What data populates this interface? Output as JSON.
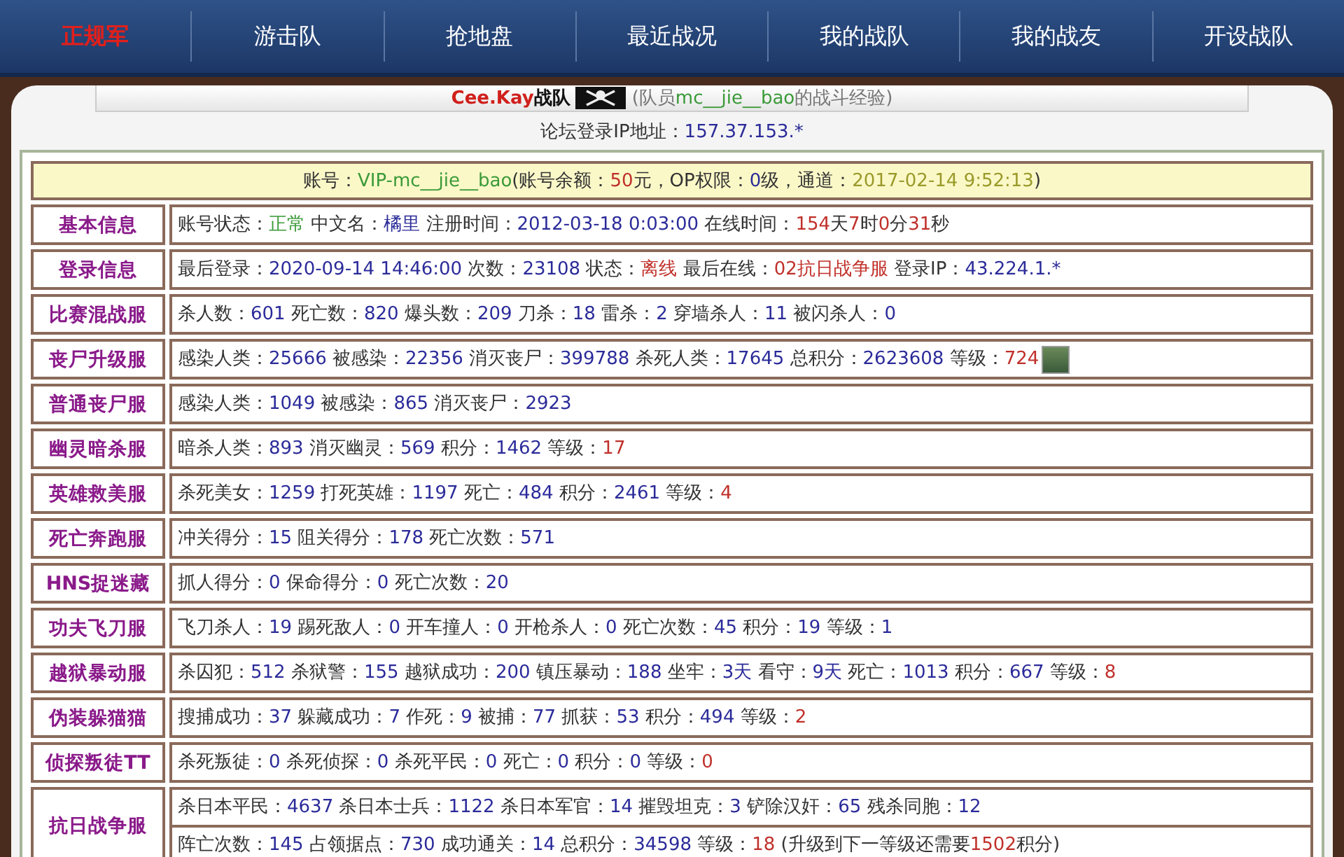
{
  "nav": {
    "items": [
      {
        "label": "正规军",
        "selected": true
      },
      {
        "label": "游击队",
        "selected": false
      },
      {
        "label": "抢地盘",
        "selected": false
      },
      {
        "label": "最近战况",
        "selected": false
      },
      {
        "label": "我的战队",
        "selected": false
      },
      {
        "label": "我的战友",
        "selected": false
      },
      {
        "label": "开设战队",
        "selected": false
      }
    ]
  },
  "header": {
    "team": "Cee.Kay",
    "team_suffix": "战队",
    "member_note": [
      {
        "text": "(队员",
        "kind": "muted"
      },
      {
        "text": "mc__jie__bao",
        "kind": "ok"
      },
      {
        "text": "的战斗经验)",
        "kind": "muted"
      }
    ]
  },
  "ip_line": [
    {
      "text": "论坛登录IP地址：",
      "kind": "label"
    },
    {
      "text": "157.37.153.*",
      "kind": "value"
    }
  ],
  "account": [
    {
      "text": "账号：",
      "kind": "label"
    },
    {
      "text": "VIP-mc__jie__bao",
      "kind": "ok"
    },
    {
      "text": "(账号余额：",
      "kind": "label"
    },
    {
      "text": "50",
      "kind": "alert"
    },
    {
      "text": "元，OP权限：",
      "kind": "label"
    },
    {
      "text": "0",
      "kind": "value"
    },
    {
      "text": "级，通道：",
      "kind": "label"
    },
    {
      "text": "2017-02-14 9:52:13",
      "kind": "date"
    },
    {
      "text": ")",
      "kind": "label"
    }
  ],
  "rows": [
    {
      "label": "基本信息",
      "lines": [
        [
          {
            "text": "账号状态：",
            "kind": "label"
          },
          {
            "text": "正常",
            "kind": "ok"
          },
          {
            "text": " 中文名：",
            "kind": "label"
          },
          {
            "text": "橘里",
            "kind": "value"
          },
          {
            "text": " 注册时间：",
            "kind": "label"
          },
          {
            "text": "2012-03-18 0:03:00",
            "kind": "value"
          },
          {
            "text": " 在线时间：",
            "kind": "label"
          },
          {
            "text": "154",
            "kind": "alert"
          },
          {
            "text": "天",
            "kind": "label"
          },
          {
            "text": "7",
            "kind": "alert"
          },
          {
            "text": "时",
            "kind": "label"
          },
          {
            "text": "0",
            "kind": "alert"
          },
          {
            "text": "分",
            "kind": "label"
          },
          {
            "text": "31",
            "kind": "alert"
          },
          {
            "text": "秒",
            "kind": "label"
          }
        ]
      ]
    },
    {
      "label": "登录信息",
      "lines": [
        [
          {
            "text": "最后登录：",
            "kind": "label"
          },
          {
            "text": "2020-09-14 14:46:00",
            "kind": "value"
          },
          {
            "text": " 次数：",
            "kind": "label"
          },
          {
            "text": "23108",
            "kind": "value"
          },
          {
            "text": " 状态：",
            "kind": "label"
          },
          {
            "text": "离线",
            "kind": "alert"
          },
          {
            "text": " 最后在线：",
            "kind": "label"
          },
          {
            "text": "02抗日战争服",
            "kind": "alert"
          },
          {
            "text": " 登录IP：",
            "kind": "label"
          },
          {
            "text": "43.224.1.*",
            "kind": "value"
          }
        ]
      ]
    },
    {
      "label": "比赛混战服",
      "lines": [
        [
          {
            "text": "杀人数：",
            "kind": "label"
          },
          {
            "text": "601",
            "kind": "value"
          },
          {
            "text": " 死亡数：",
            "kind": "label"
          },
          {
            "text": "820",
            "kind": "value"
          },
          {
            "text": " 爆头数：",
            "kind": "label"
          },
          {
            "text": "209",
            "kind": "value"
          },
          {
            "text": " 刀杀：",
            "kind": "label"
          },
          {
            "text": "18",
            "kind": "value"
          },
          {
            "text": " 雷杀：",
            "kind": "label"
          },
          {
            "text": "2",
            "kind": "value"
          },
          {
            "text": " 穿墙杀人：",
            "kind": "label"
          },
          {
            "text": "11",
            "kind": "value"
          },
          {
            "text": " 被闪杀人：",
            "kind": "label"
          },
          {
            "text": "0",
            "kind": "value"
          }
        ]
      ]
    },
    {
      "label": "丧尸升级服",
      "avatar": true,
      "lines": [
        [
          {
            "text": "感染人类：",
            "kind": "label"
          },
          {
            "text": "25666",
            "kind": "value"
          },
          {
            "text": " 被感染：",
            "kind": "label"
          },
          {
            "text": "22356",
            "kind": "value"
          },
          {
            "text": " 消灭丧尸：",
            "kind": "label"
          },
          {
            "text": "399788",
            "kind": "value"
          },
          {
            "text": " 杀死人类：",
            "kind": "label"
          },
          {
            "text": "17645",
            "kind": "value"
          },
          {
            "text": " 总积分：",
            "kind": "label"
          },
          {
            "text": "2623608",
            "kind": "value"
          },
          {
            "text": " 等级：",
            "kind": "label"
          },
          {
            "text": "724",
            "kind": "alert"
          }
        ]
      ]
    },
    {
      "label": "普通丧尸服",
      "lines": [
        [
          {
            "text": "感染人类：",
            "kind": "label"
          },
          {
            "text": "1049",
            "kind": "value"
          },
          {
            "text": " 被感染：",
            "kind": "label"
          },
          {
            "text": "865",
            "kind": "value"
          },
          {
            "text": " 消灭丧尸：",
            "kind": "label"
          },
          {
            "text": "2923",
            "kind": "value"
          }
        ]
      ]
    },
    {
      "label": "幽灵暗杀服",
      "lines": [
        [
          {
            "text": "暗杀人类：",
            "kind": "label"
          },
          {
            "text": "893",
            "kind": "value"
          },
          {
            "text": " 消灭幽灵：",
            "kind": "label"
          },
          {
            "text": "569",
            "kind": "value"
          },
          {
            "text": " 积分：",
            "kind": "label"
          },
          {
            "text": "1462",
            "kind": "value"
          },
          {
            "text": " 等级：",
            "kind": "label"
          },
          {
            "text": "17",
            "kind": "alert"
          }
        ]
      ]
    },
    {
      "label": "英雄救美服",
      "lines": [
        [
          {
            "text": "杀死美女：",
            "kind": "label"
          },
          {
            "text": "1259",
            "kind": "value"
          },
          {
            "text": " 打死英雄：",
            "kind": "label"
          },
          {
            "text": "1197",
            "kind": "value"
          },
          {
            "text": " 死亡：",
            "kind": "label"
          },
          {
            "text": "484",
            "kind": "value"
          },
          {
            "text": " 积分：",
            "kind": "label"
          },
          {
            "text": "2461",
            "kind": "value"
          },
          {
            "text": " 等级：",
            "kind": "label"
          },
          {
            "text": "4",
            "kind": "alert"
          }
        ]
      ]
    },
    {
      "label": "死亡奔跑服",
      "lines": [
        [
          {
            "text": "冲关得分：",
            "kind": "label"
          },
          {
            "text": "15",
            "kind": "value"
          },
          {
            "text": " 阻关得分：",
            "kind": "label"
          },
          {
            "text": "178",
            "kind": "value"
          },
          {
            "text": " 死亡次数：",
            "kind": "label"
          },
          {
            "text": "571",
            "kind": "value"
          }
        ]
      ]
    },
    {
      "label": "HNS捉迷藏",
      "lines": [
        [
          {
            "text": "抓人得分：",
            "kind": "label"
          },
          {
            "text": "0",
            "kind": "value"
          },
          {
            "text": " 保命得分：",
            "kind": "label"
          },
          {
            "text": "0",
            "kind": "value"
          },
          {
            "text": " 死亡次数：",
            "kind": "label"
          },
          {
            "text": "20",
            "kind": "value"
          }
        ]
      ]
    },
    {
      "label": "功夫飞刀服",
      "lines": [
        [
          {
            "text": "飞刀杀人：",
            "kind": "label"
          },
          {
            "text": "19",
            "kind": "value"
          },
          {
            "text": " 踢死敌人：",
            "kind": "label"
          },
          {
            "text": "0",
            "kind": "value"
          },
          {
            "text": " 开车撞人：",
            "kind": "label"
          },
          {
            "text": "0",
            "kind": "value"
          },
          {
            "text": " 开枪杀人：",
            "kind": "label"
          },
          {
            "text": "0",
            "kind": "value"
          },
          {
            "text": " 死亡次数：",
            "kind": "label"
          },
          {
            "text": "45",
            "kind": "value"
          },
          {
            "text": " 积分：",
            "kind": "label"
          },
          {
            "text": "19",
            "kind": "value"
          },
          {
            "text": " 等级：",
            "kind": "label"
          },
          {
            "text": "1",
            "kind": "value"
          }
        ]
      ]
    },
    {
      "label": "越狱暴动服",
      "lines": [
        [
          {
            "text": "杀囚犯：",
            "kind": "label"
          },
          {
            "text": "512",
            "kind": "value"
          },
          {
            "text": " 杀狱警：",
            "kind": "label"
          },
          {
            "text": "155",
            "kind": "value"
          },
          {
            "text": " 越狱成功：",
            "kind": "label"
          },
          {
            "text": "200",
            "kind": "value"
          },
          {
            "text": " 镇压暴动：",
            "kind": "label"
          },
          {
            "text": "188",
            "kind": "value"
          },
          {
            "text": " 坐牢：",
            "kind": "label"
          },
          {
            "text": "3天",
            "kind": "value"
          },
          {
            "text": " 看守：",
            "kind": "label"
          },
          {
            "text": "9天",
            "kind": "value"
          },
          {
            "text": " 死亡：",
            "kind": "label"
          },
          {
            "text": "1013",
            "kind": "value"
          },
          {
            "text": " 积分：",
            "kind": "label"
          },
          {
            "text": "667",
            "kind": "value"
          },
          {
            "text": " 等级：",
            "kind": "label"
          },
          {
            "text": "8",
            "kind": "alert"
          }
        ]
      ]
    },
    {
      "label": "伪装躲猫猫",
      "lines": [
        [
          {
            "text": "搜捕成功：",
            "kind": "label"
          },
          {
            "text": "37",
            "kind": "value"
          },
          {
            "text": " 躲藏成功：",
            "kind": "label"
          },
          {
            "text": "7",
            "kind": "value"
          },
          {
            "text": " 作死：",
            "kind": "label"
          },
          {
            "text": "9",
            "kind": "value"
          },
          {
            "text": " 被捕：",
            "kind": "label"
          },
          {
            "text": "77",
            "kind": "value"
          },
          {
            "text": " 抓获：",
            "kind": "label"
          },
          {
            "text": "53",
            "kind": "value"
          },
          {
            "text": " 积分：",
            "kind": "label"
          },
          {
            "text": "494",
            "kind": "value"
          },
          {
            "text": " 等级：",
            "kind": "label"
          },
          {
            "text": "2",
            "kind": "alert"
          }
        ]
      ]
    },
    {
      "label": "侦探叛徒TT",
      "lines": [
        [
          {
            "text": "杀死叛徒：",
            "kind": "label"
          },
          {
            "text": "0",
            "kind": "value"
          },
          {
            "text": " 杀死侦探：",
            "kind": "label"
          },
          {
            "text": "0",
            "kind": "value"
          },
          {
            "text": " 杀死平民：",
            "kind": "label"
          },
          {
            "text": "0",
            "kind": "value"
          },
          {
            "text": " 死亡：",
            "kind": "label"
          },
          {
            "text": "0",
            "kind": "value"
          },
          {
            "text": " 积分：",
            "kind": "label"
          },
          {
            "text": "0",
            "kind": "value"
          },
          {
            "text": " 等级：",
            "kind": "label"
          },
          {
            "text": "0",
            "kind": "alert"
          }
        ]
      ]
    },
    {
      "label": "抗日战争服",
      "lines": [
        [
          {
            "text": "杀日本平民：",
            "kind": "label"
          },
          {
            "text": "4637",
            "kind": "value"
          },
          {
            "text": " 杀日本士兵：",
            "kind": "label"
          },
          {
            "text": "1122",
            "kind": "value"
          },
          {
            "text": " 杀日本军官：",
            "kind": "label"
          },
          {
            "text": "14",
            "kind": "value"
          },
          {
            "text": " 摧毁坦克：",
            "kind": "label"
          },
          {
            "text": "3",
            "kind": "value"
          },
          {
            "text": " 铲除汉奸：",
            "kind": "label"
          },
          {
            "text": "65",
            "kind": "value"
          },
          {
            "text": " 残杀同胞：",
            "kind": "label"
          },
          {
            "text": "12",
            "kind": "value"
          }
        ],
        [
          {
            "text": "阵亡次数：",
            "kind": "label"
          },
          {
            "text": "145",
            "kind": "value"
          },
          {
            "text": " 占领据点：",
            "kind": "label"
          },
          {
            "text": "730",
            "kind": "value"
          },
          {
            "text": " 成功通关：",
            "kind": "label"
          },
          {
            "text": "14",
            "kind": "value"
          },
          {
            "text": " 总积分：",
            "kind": "label"
          },
          {
            "text": "34598",
            "kind": "value"
          },
          {
            "text": " 等级：",
            "kind": "label"
          },
          {
            "text": "18",
            "kind": "alert"
          },
          {
            "text": " (升级到下一等级还需要",
            "kind": "label"
          },
          {
            "text": "1502",
            "kind": "alert"
          },
          {
            "text": "积分)",
            "kind": "label"
          }
        ]
      ]
    }
  ]
}
